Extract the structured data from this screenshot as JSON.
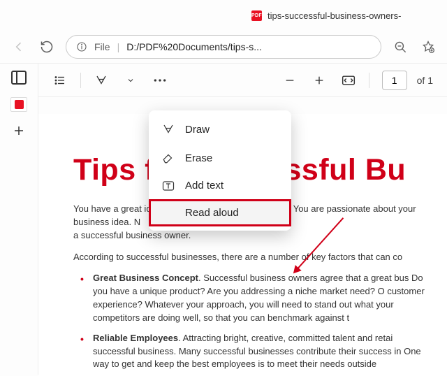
{
  "tab": {
    "title": "tips-successful-business-owners-"
  },
  "addressbar": {
    "source_label": "File",
    "url": "D:/PDF%20Documents/tips-s..."
  },
  "pdfbar": {
    "page_current": "1",
    "page_total": "of 1"
  },
  "menu": {
    "draw": "Draw",
    "erase": "Erase",
    "add_text": "Add text",
    "read_aloud": "Read aloud"
  },
  "doc": {
    "title": "Tips for Successful Bu",
    "p1": "You have a great idea and you've done your research. You are passionate about your business idea. N",
    "p1b": "a successful business owner.",
    "p2": "According to successful businesses, there are a number of key factors that can co",
    "li1b": "Great Business Concept",
    "li1": ". Successful business owners agree that a great bus Do you have a unique product? Are you addressing a niche market need? O customer experience? Whatever your approach, you will need to stand out what your competitors are doing well, so that you can benchmark against t",
    "li2b": "Reliable Employees",
    "li2": ". Attracting bright, creative, committed talent and retai successful business. Many successful businesses contribute their success in One way to get and keep the best employees is to meet their needs outside"
  }
}
